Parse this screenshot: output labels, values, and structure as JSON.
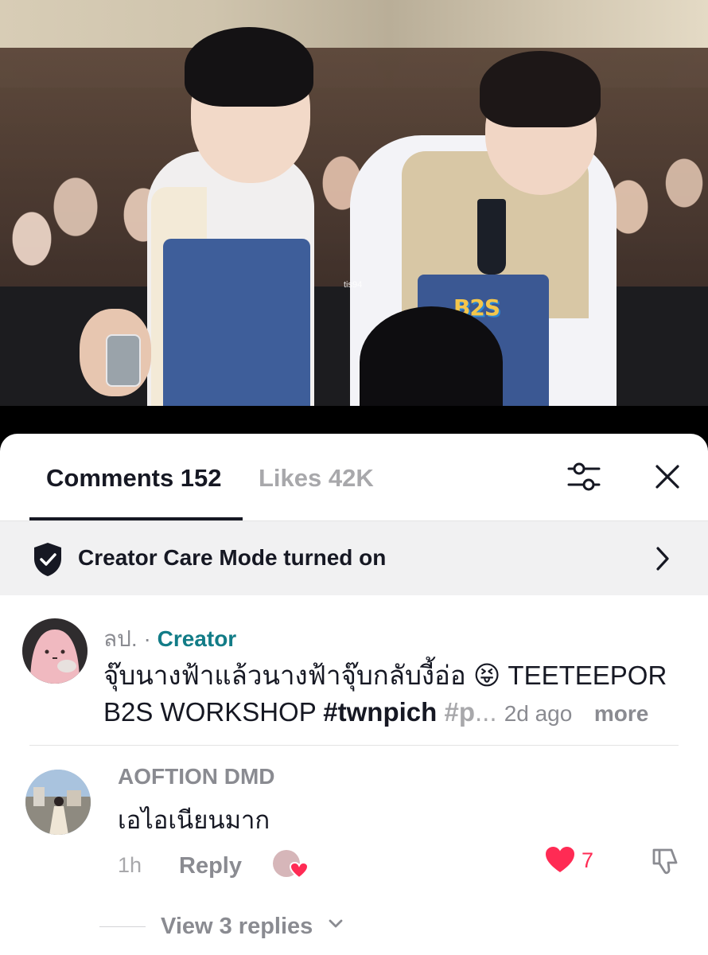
{
  "video": {
    "watermark": "tis94",
    "apron_logo": "B2S"
  },
  "tabs": {
    "comments_label": "Comments 152",
    "likes_label": "Likes 42K"
  },
  "icons": {
    "filter": "filter-sliders-icon",
    "close": "close-icon",
    "shield": "shield-check-icon",
    "chevron": "chevron-right-icon",
    "heart": "heart-icon",
    "dislike": "dislike-icon"
  },
  "care_mode": {
    "text": "Creator Care Mode turned on"
  },
  "caption": {
    "username": "ลป.",
    "separator": " · ",
    "role": "Creator",
    "text_line1": "จุ๊บนางฟ้าแล้วนางฟ้าจุ๊บกลับงี้อ่อ 😝 TEETEEPOR",
    "text_line2_plain": "B2S WORKSHOP ",
    "hashtag": "#twnpich",
    "hashtag_cut": " #p",
    "ellipsis": "...",
    "time": "2d ago",
    "more_label": "more"
  },
  "comment": {
    "username": "AOFTION DMD",
    "text": "เอไอเนียนมาก",
    "time": "1h",
    "reply_label": "Reply",
    "likes": "7",
    "view_replies_label": "View 3 replies"
  },
  "colors": {
    "accent_like": "#ff2b54",
    "creator_teal": "#127c87",
    "text_primary": "#161823",
    "text_secondary": "#8a8b91"
  }
}
